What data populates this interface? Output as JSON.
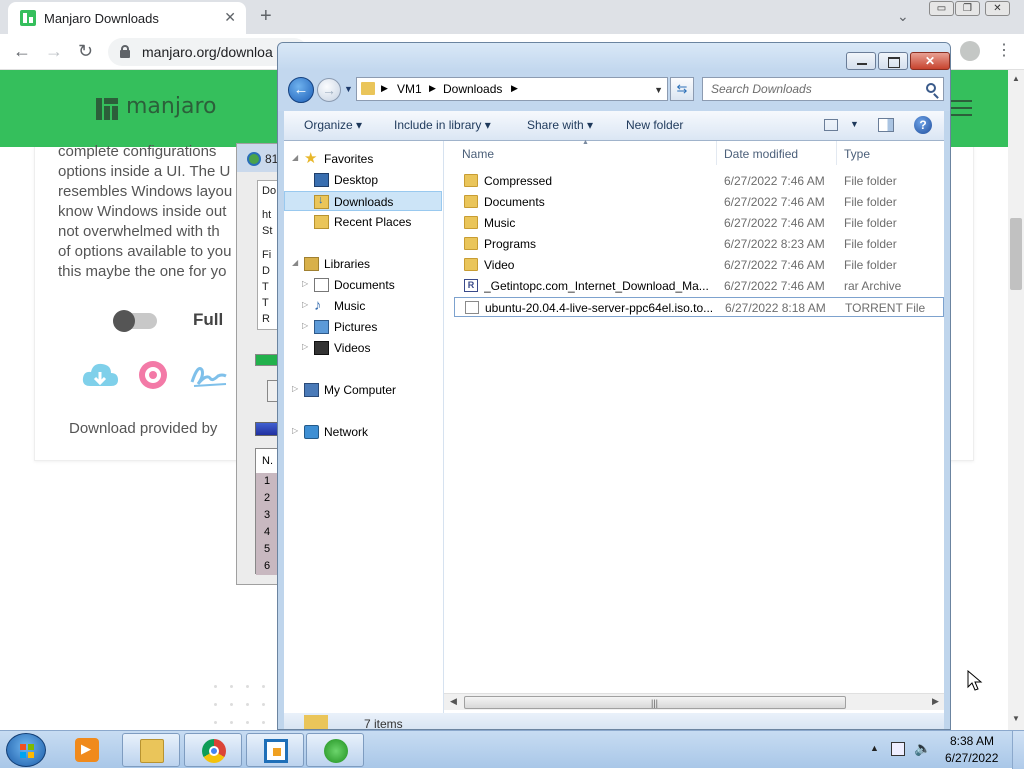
{
  "browser": {
    "tab_title": "Manjaro Downloads",
    "tab_close": "✕",
    "new_tab": "+",
    "url": "manjaro.org/downloa",
    "nav_back": "←",
    "nav_forward": "→",
    "nav_reload": "↻",
    "menu": "⋮",
    "tab_search": "⌄"
  },
  "page": {
    "logo_text": "manjaro",
    "description_lines": [
      "complete configurations",
      "options inside a UI. The U",
      "resembles Windows layou",
      "know Windows inside out",
      "not overwhelmed with th",
      "of options available to you",
      "this maybe the one for yo"
    ],
    "full_label": "Full",
    "provided_by": "Download provided by",
    "colors": {
      "accent": "#35bf5c",
      "logo": "#2c5f3a"
    }
  },
  "idm": {
    "title_fragment": "81",
    "panel_lines": [
      "Do",
      "ht",
      "St",
      "Fi",
      "D",
      "T",
      "T",
      "R"
    ],
    "list_header": "N.",
    "list_rows": [
      "1",
      "2",
      "3",
      "4",
      "5",
      "6"
    ]
  },
  "explorer": {
    "close_label": "✕",
    "breadcrumb": [
      "VM1",
      "Downloads"
    ],
    "search_placeholder": "Search Downloads",
    "toolbar": {
      "organize": "Organize",
      "include_in_library": "Include in library",
      "share_with": "Share with",
      "new_folder": "New folder"
    },
    "nav": {
      "favorites": "Favorites",
      "desktop": "Desktop",
      "downloads": "Downloads",
      "recent_places": "Recent Places",
      "libraries": "Libraries",
      "documents": "Documents",
      "music": "Music",
      "pictures": "Pictures",
      "videos": "Videos",
      "my_computer": "My Computer",
      "network": "Network"
    },
    "columns": {
      "name": "Name",
      "date": "Date modified",
      "type": "Type"
    },
    "files": [
      {
        "name": "Compressed",
        "date": "6/27/2022 7:46 AM",
        "type": "File folder",
        "icon": "folder-icon"
      },
      {
        "name": "Documents",
        "date": "6/27/2022 7:46 AM",
        "type": "File folder",
        "icon": "folder-icon"
      },
      {
        "name": "Music",
        "date": "6/27/2022 7:46 AM",
        "type": "File folder",
        "icon": "folder-icon"
      },
      {
        "name": "Programs",
        "date": "6/27/2022 8:23 AM",
        "type": "File folder",
        "icon": "folder-icon"
      },
      {
        "name": "Video",
        "date": "6/27/2022 7:46 AM",
        "type": "File folder",
        "icon": "folder-icon"
      },
      {
        "name": "_Getintopc.com_Internet_Download_Ma...",
        "date": "6/27/2022 7:46 AM",
        "type": "rar Archive",
        "icon": "rar-archive-icon"
      },
      {
        "name": "ubuntu-20.04.4-live-server-ppc64el.iso.to...",
        "date": "6/27/2022 8:18 AM",
        "type": "TORRENT File",
        "icon": "torrent-file-icon"
      }
    ],
    "status": "7 items"
  },
  "taskbar": {
    "time": "8:38 AM",
    "date": "6/27/2022"
  }
}
